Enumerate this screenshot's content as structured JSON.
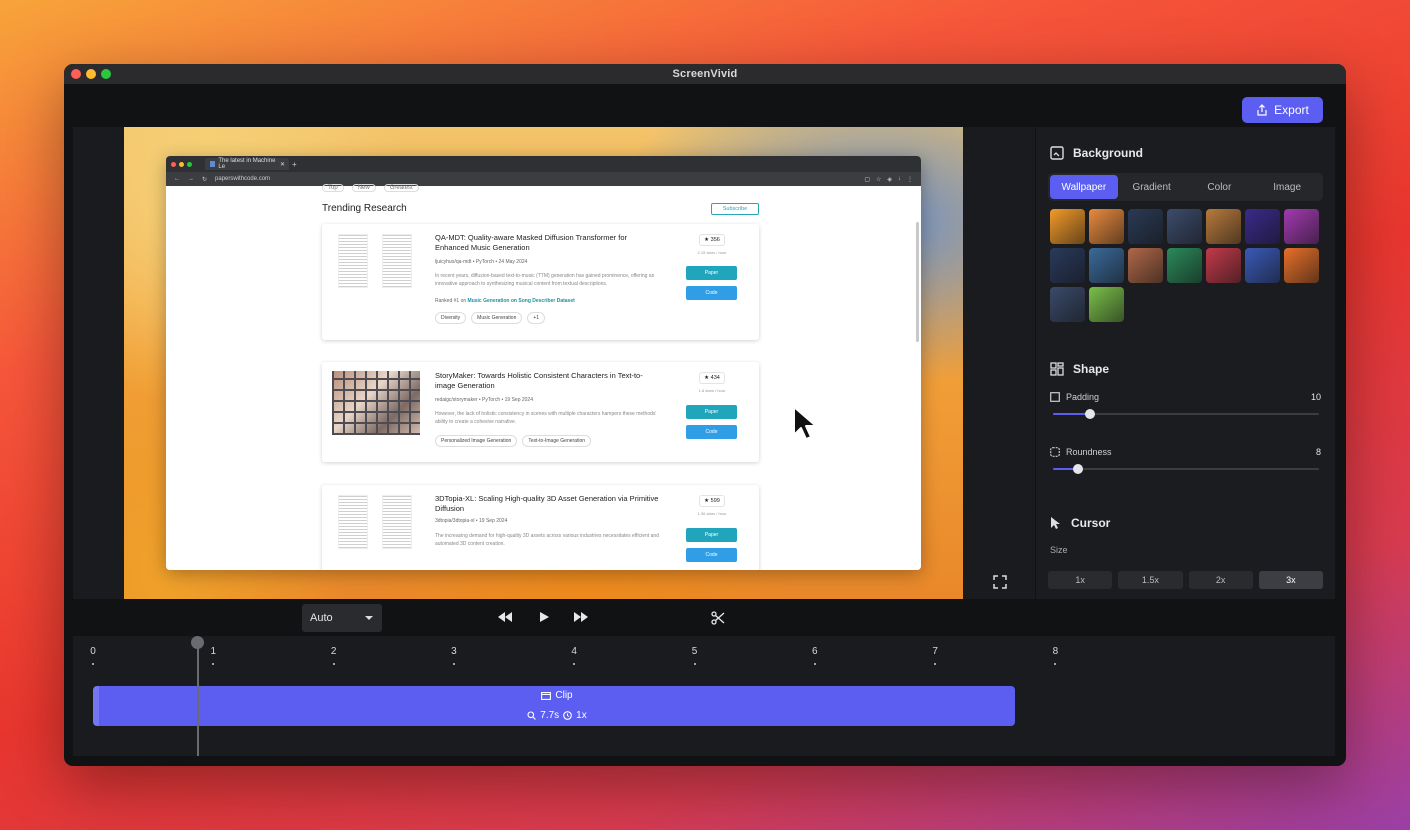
{
  "window": {
    "title": "ScreenVivid"
  },
  "toolbar": {
    "export_label": "Export"
  },
  "browser": {
    "tab_title": "The latest in Machine Le",
    "url": "paperswithcode.com",
    "filters": [
      "Top",
      "New",
      "Greatest"
    ],
    "section_title": "Trending Research",
    "subscribe_label": "Subscribe",
    "cards": [
      {
        "title": "QA-MDT: Quality-aware Masked Diffusion Transformer for Enhanced Music Generation",
        "meta": "ljuicyhuo/qa-mdt • PyTorch • 24 May 2024",
        "description": "In recent years, diffusion-based text-to-music (TTM) generation has gained prominence, offering an innovative approach to synthesizing musical content from textual descriptions.",
        "rank_prefix": "Ranked #1 on",
        "rank_link": "Music Generation on Song Describer Dataset",
        "tags": [
          "Diversity",
          "Music Generation",
          "+1"
        ],
        "stars": "356",
        "stars_per_hour": "2.15 stars / hour",
        "paper_label": "Paper",
        "code_label": "Code"
      },
      {
        "title": "StoryMaker: Towards Holistic Consistent Characters in Text-to-image Generation",
        "meta": "redaigc/storymaker • PyTorch • 19 Sep 2024",
        "description": "However, the lack of holistic consistency in scenes with multiple characters hampers these methods' ability to create a cohesive narrative.",
        "tags": [
          "Personalized Image Generation",
          "Text-to-Image Generation"
        ],
        "stars": "434",
        "stars_per_hour": "1.8 stars / hour",
        "paper_label": "Paper",
        "code_label": "Code"
      },
      {
        "title": "3DTopia-XL: Scaling High-quality 3D Asset Generation via Primitive Diffusion",
        "meta": "3dtopia/3dtopia-xl • 19 Sep 2024",
        "description": "The increasing demand for high-quality 3D assets across various industries necessitates efficient and automated 3D content creation.",
        "stars": "599",
        "stars_per_hour": "1.36 stars / hour",
        "paper_label": "Paper",
        "code_label": "Code"
      }
    ]
  },
  "sidebar": {
    "background": {
      "title": "Background",
      "tabs": [
        "Wallpaper",
        "Gradient",
        "Color",
        "Image"
      ],
      "active_tab": "Wallpaper",
      "wallpapers": [
        "#f39a2a",
        "#e98a3e",
        "#2a3a55",
        "#3c4c6c",
        "#b87a3c",
        "#3b2a8c",
        "#a23ab0",
        "#2a3a5c",
        "#3a6a9a",
        "#b06848",
        "#2a8a5a",
        "#c23a4a",
        "#3a5ab8",
        "#e8702a",
        "#3a4a6a",
        "#7ac04a"
      ]
    },
    "shape": {
      "title": "Shape",
      "padding_label": "Padding",
      "padding_value": "10",
      "padding_fraction": 0.14,
      "roundness_label": "Roundness",
      "roundness_value": "8",
      "roundness_fraction": 0.095
    },
    "cursor": {
      "title": "Cursor",
      "size_label": "Size",
      "sizes": [
        "1x",
        "1.5x",
        "2x",
        "3x"
      ],
      "active_size": "3x"
    }
  },
  "playback": {
    "speed_select": "Auto"
  },
  "timeline": {
    "ticks": [
      "0",
      "1",
      "2",
      "3",
      "4",
      "5",
      "6",
      "7",
      "8"
    ],
    "clip_label": "Clip",
    "clip_duration": "7.7s",
    "clip_speed": "1x",
    "playhead_seconds": 0.87
  }
}
